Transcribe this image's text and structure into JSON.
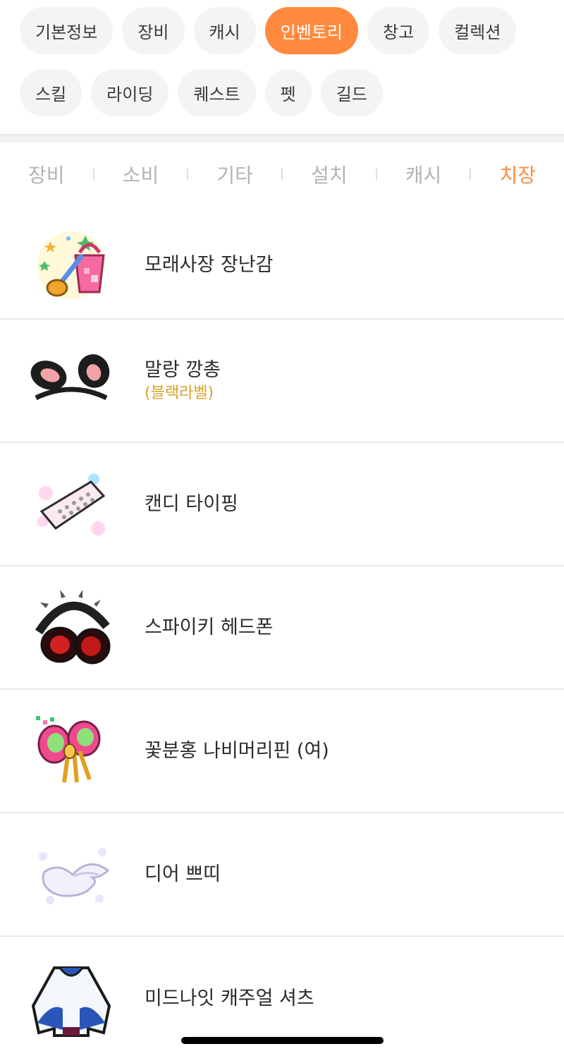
{
  "main_tabs": [
    "기본정보",
    "장비",
    "캐시",
    "인벤토리",
    "창고",
    "컬렉션",
    "스킬",
    "라이딩",
    "퀘스트",
    "펫",
    "길드"
  ],
  "active_main_tab": "인벤토리",
  "sub_tabs": [
    "장비",
    "소비",
    "기타",
    "설치",
    "캐시",
    "치장"
  ],
  "active_sub_tab": "치장",
  "items": [
    {
      "name": "모래사장 장난감",
      "tag": "",
      "icon": "sand-bucket-icon"
    },
    {
      "name": "말랑 깡총",
      "tag": "(블랙라벨)",
      "icon": "bunny-ears-icon"
    },
    {
      "name": "캔디 타이핑",
      "tag": "",
      "icon": "candy-keyboard-icon"
    },
    {
      "name": "스파이키 헤드폰",
      "tag": "",
      "icon": "spiky-headphones-icon"
    },
    {
      "name": "꽃분홍 나비머리핀 (여)",
      "tag": "",
      "icon": "butterfly-hairpin-icon"
    },
    {
      "name": "디어 쁘띠",
      "tag": "",
      "icon": "wing-icon"
    },
    {
      "name": "미드나잇 캐주얼 셔츠",
      "tag": "",
      "icon": "shirt-icon"
    }
  ],
  "colors": {
    "accent": "#ff8a3d",
    "label_gold": "#d9a227"
  }
}
